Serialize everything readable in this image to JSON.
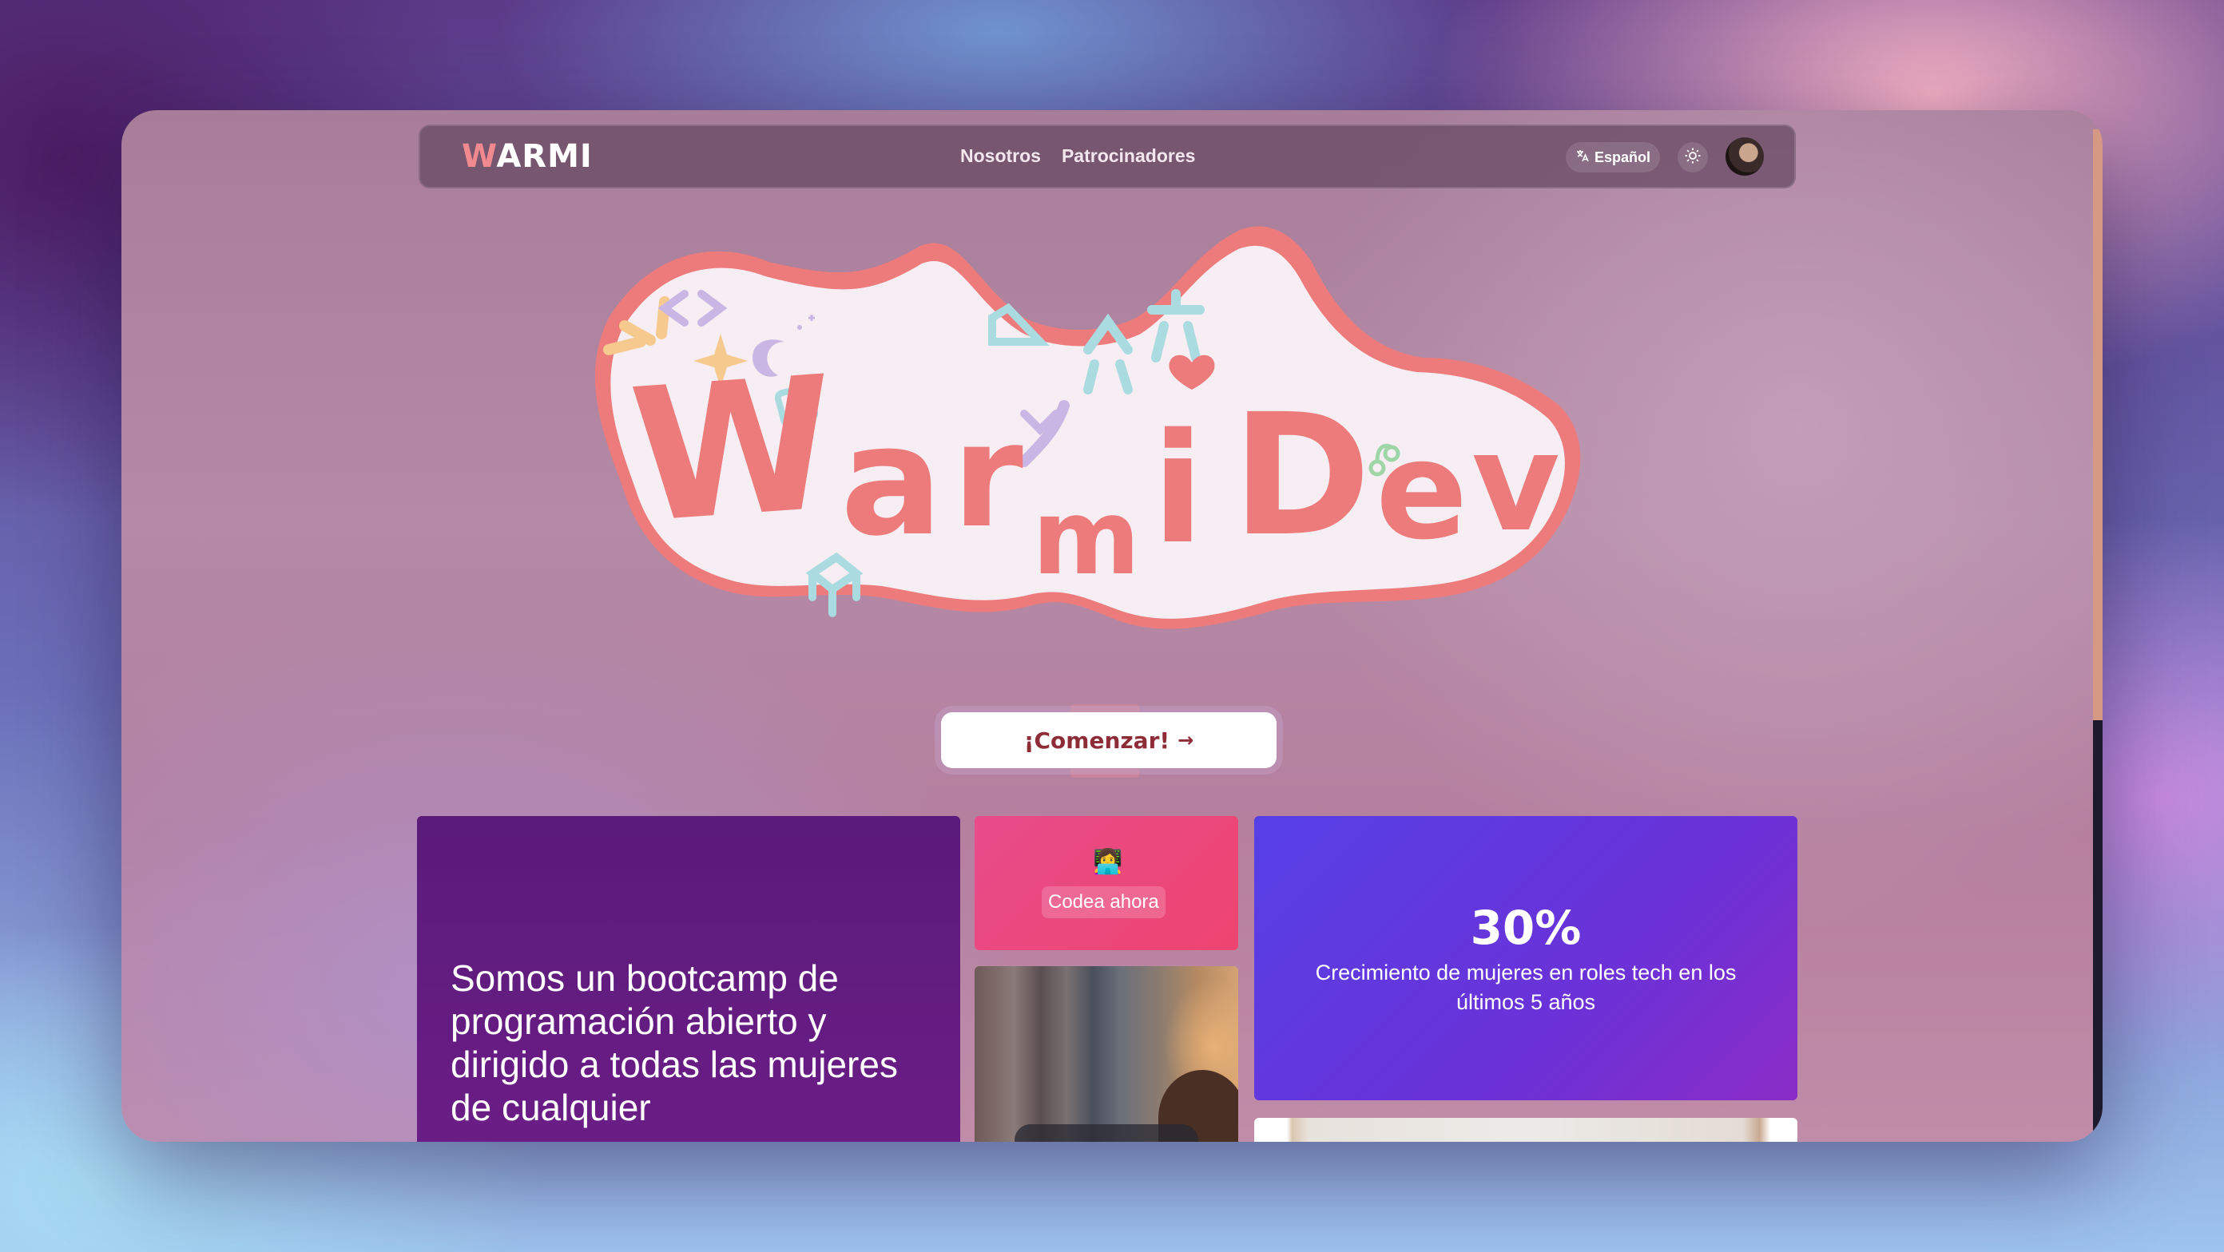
{
  "nav": {
    "logo": "WARMI",
    "links": [
      "Nosotros",
      "Patrocinadores"
    ],
    "language": "Español",
    "language_icon": "translate-icon",
    "theme_icon": "sun-icon"
  },
  "hero": {
    "logo_text": "WarmiDev",
    "colors": {
      "primary": "#ee7b7c",
      "blob": "#f6eef2",
      "outline": "#ee7b7c",
      "accent_cyan": "#a9dbe0",
      "accent_lilac": "#c9b6e4",
      "accent_yellow": "#f6c98e"
    }
  },
  "cta": {
    "label": "¡Comenzar!",
    "arrow": "→"
  },
  "cards": {
    "mission": "Somos un bootcamp de programación abierto y dirigido a todas las mujeres de cualquier",
    "code_now": {
      "emoji": "👩‍💻",
      "label": "Codea ahora"
    },
    "stat": {
      "value": "30%",
      "description": "Crecimiento de mujeres en roles tech en los últimos 5 años"
    }
  }
}
